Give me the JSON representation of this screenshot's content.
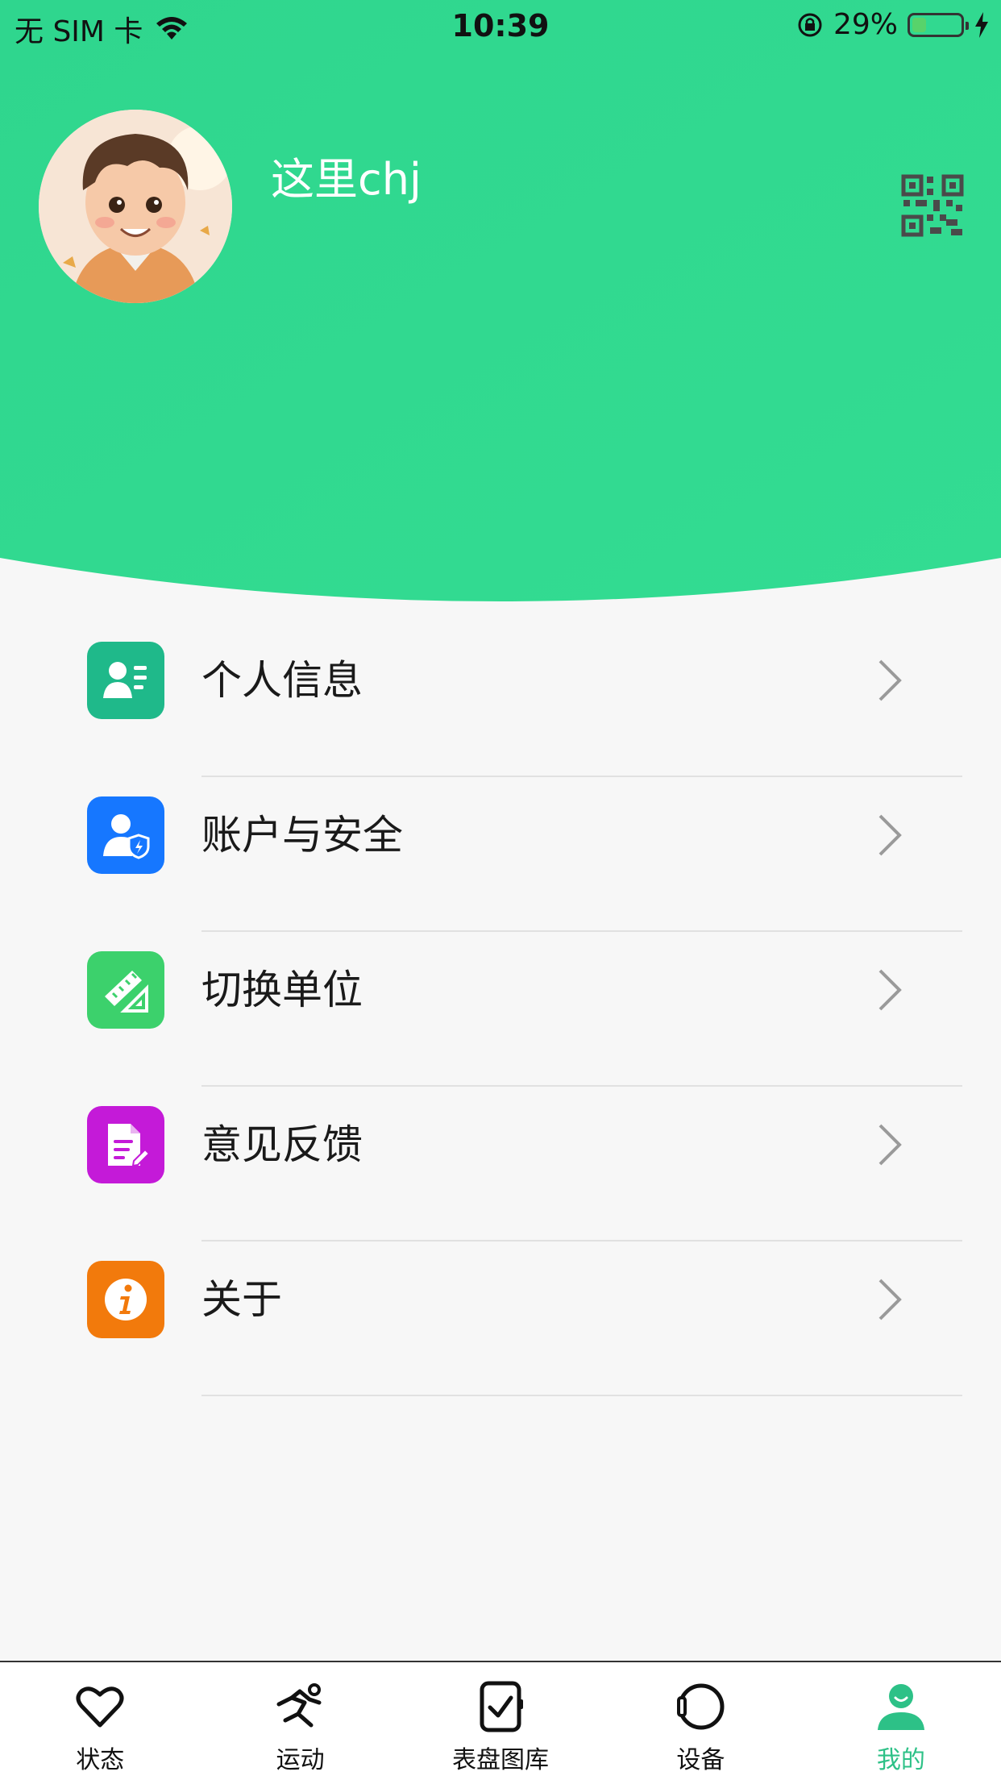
{
  "status_bar": {
    "carrier": "无 SIM 卡",
    "time": "10:39",
    "battery": "29%",
    "battery_level": 0.29,
    "icons": [
      "wifi-icon",
      "orientation-lock-icon",
      "battery-icon",
      "charging-bolt-icon"
    ]
  },
  "profile": {
    "username": "这里chj",
    "avatar_icon": "avatar-cartoon-boy",
    "qr_icon": "qr-code-icon"
  },
  "colors": {
    "header_green": "#2fd68e",
    "active_tab": "#2dc187",
    "personal_info": "#1fb98a",
    "account_security": "#1677ff",
    "switch_unit": "#3cd16c",
    "feedback": "#c41ad8",
    "about": "#f27a0c"
  },
  "menu": {
    "items": [
      {
        "label": "个人信息",
        "icon": "personal-info-icon"
      },
      {
        "label": "账户与安全",
        "icon": "account-security-icon"
      },
      {
        "label": "切换单位",
        "icon": "ruler-icon"
      },
      {
        "label": "意见反馈",
        "icon": "feedback-icon"
      },
      {
        "label": "关于",
        "icon": "info-icon"
      }
    ]
  },
  "tabbar": {
    "tabs": [
      {
        "label": "状态",
        "icon": "heart-icon",
        "active": false
      },
      {
        "label": "运动",
        "icon": "running-icon",
        "active": false
      },
      {
        "label": "表盘图库",
        "icon": "watch-face-icon",
        "active": false
      },
      {
        "label": "设备",
        "icon": "device-icon",
        "active": false
      },
      {
        "label": "我的",
        "icon": "profile-icon",
        "active": true
      }
    ]
  }
}
